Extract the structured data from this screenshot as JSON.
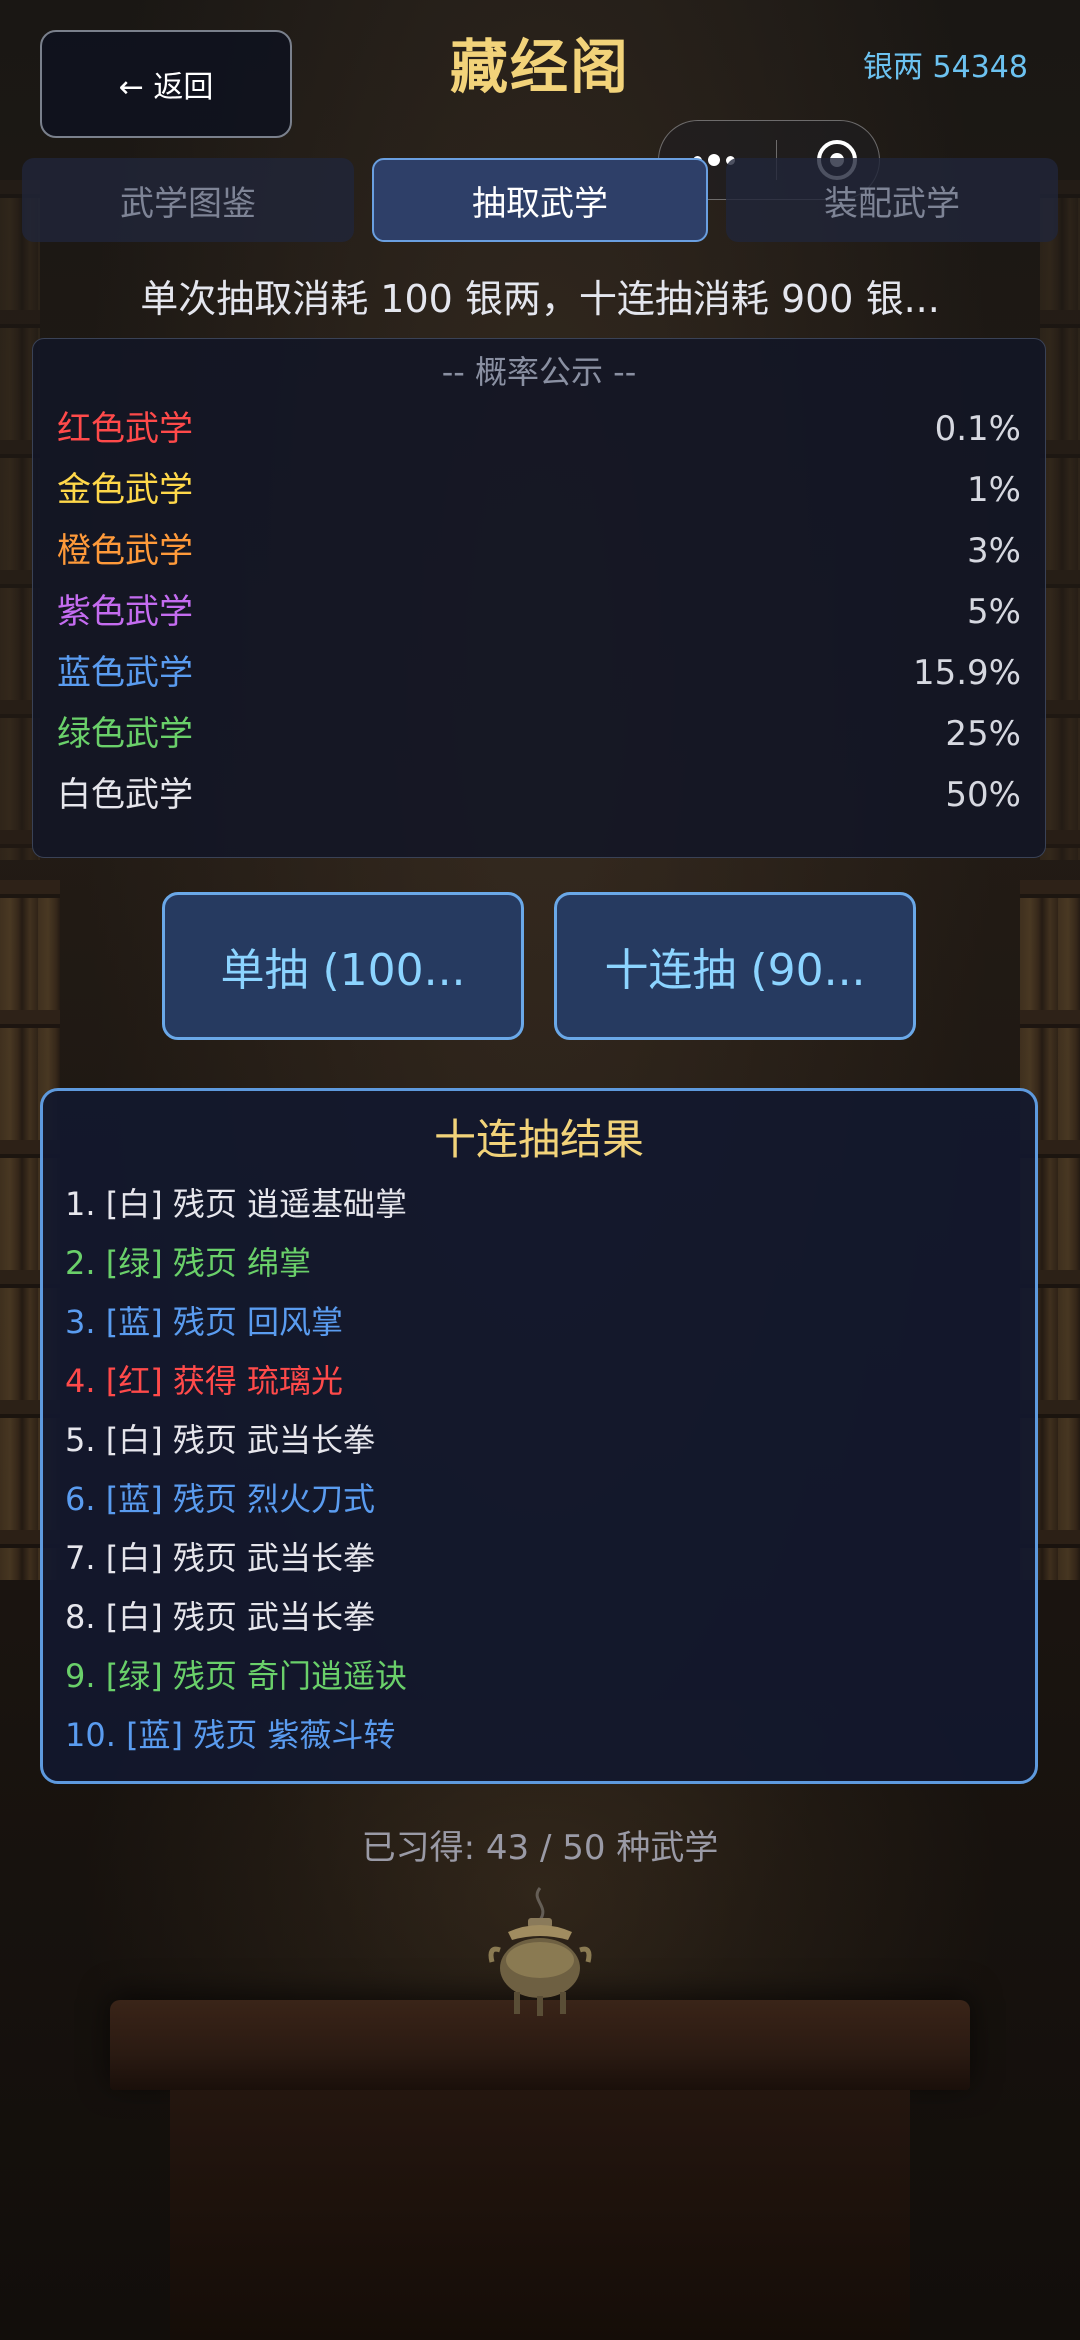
{
  "header": {
    "back_label": "← 返回",
    "title": "藏经阁",
    "silver_label": "银两 54348"
  },
  "tabs": [
    {
      "label": "武学图鉴",
      "active": false
    },
    {
      "label": "抽取武学",
      "active": true
    },
    {
      "label": "装配武学",
      "active": false
    }
  ],
  "notice": "单次抽取消耗 100 银两，十连抽消耗 900 银...",
  "probability": {
    "title": "-- 概率公示 --",
    "rows": [
      {
        "label": "红色武学",
        "value": "0.1%",
        "color": "#ff4a4a"
      },
      {
        "label": "金色武学",
        "value": "1%",
        "color": "#ffd84a"
      },
      {
        "label": "橙色武学",
        "value": "3%",
        "color": "#ff9a3a"
      },
      {
        "label": "紫色武学",
        "value": "5%",
        "color": "#c46cf0"
      },
      {
        "label": "蓝色武学",
        "value": "15.9%",
        "color": "#5a9cf0"
      },
      {
        "label": "绿色武学",
        "value": "25%",
        "color": "#6ad06a"
      },
      {
        "label": "白色武学",
        "value": "50%",
        "color": "#e6e6ec"
      }
    ]
  },
  "buttons": {
    "single": "单抽 (100...",
    "ten": "十连抽 (90..."
  },
  "results": {
    "title": "十连抽结果",
    "items": [
      {
        "text": "1. [白] 残页 逍遥基础掌",
        "color": "#e6e6ec"
      },
      {
        "text": "2. [绿] 残页 绵掌",
        "color": "#6ad06a"
      },
      {
        "text": "3. [蓝] 残页 回风掌",
        "color": "#5a9cf0"
      },
      {
        "text": "4. [红] 获得 琉璃光",
        "color": "#ff4a4a"
      },
      {
        "text": "5. [白] 残页 武当长拳",
        "color": "#e6e6ec"
      },
      {
        "text": "6. [蓝] 残页 烈火刀式",
        "color": "#5a9cf0"
      },
      {
        "text": "7. [白] 残页 武当长拳",
        "color": "#e6e6ec"
      },
      {
        "text": "8. [白] 残页 武当长拳",
        "color": "#e6e6ec"
      },
      {
        "text": "9. [绿] 残页 奇门逍遥诀",
        "color": "#6ad06a"
      },
      {
        "text": "10. [蓝] 残页 紫薇斗转",
        "color": "#5a9cf0"
      }
    ]
  },
  "footer": {
    "learned": "已习得: 43 / 50 种武学"
  },
  "capsule": {
    "icons": [
      "more-dots-icon",
      "close-target-icon"
    ]
  }
}
